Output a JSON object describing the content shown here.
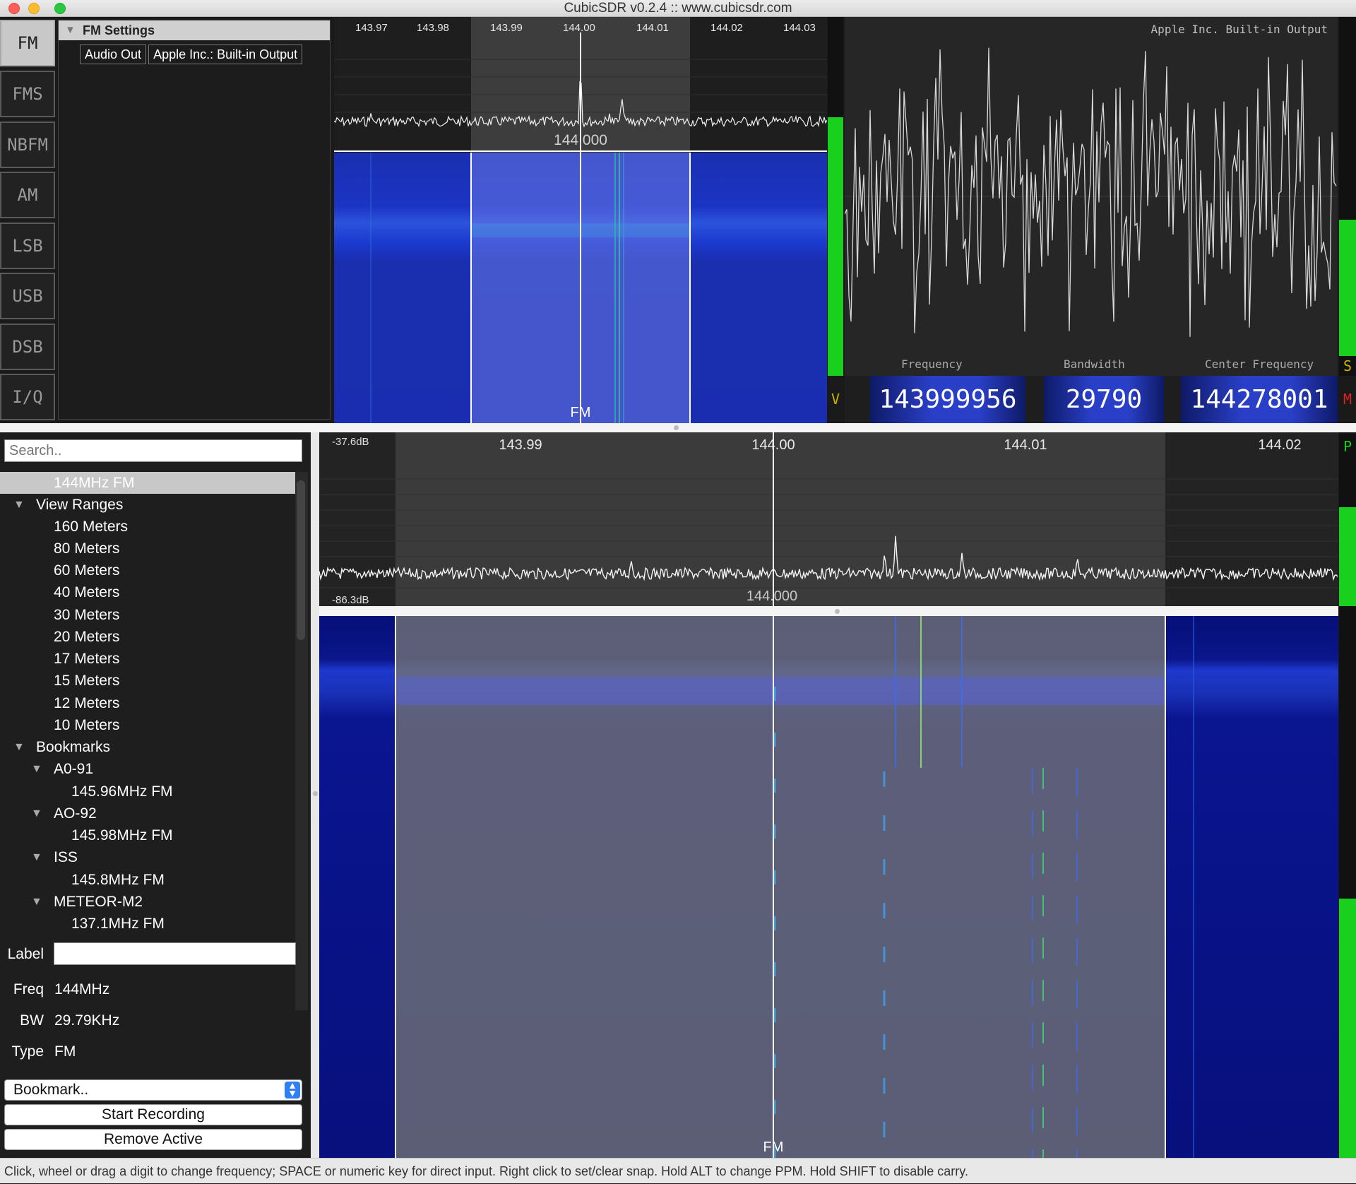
{
  "window": {
    "title": "CubicSDR v0.2.4 :: www.cubicsdr.com"
  },
  "modes": [
    "FM",
    "FMS",
    "NBFM",
    "AM",
    "LSB",
    "USB",
    "DSB",
    "I/Q"
  ],
  "active_mode": "FM",
  "settings": {
    "title": "FM Settings",
    "audio_out_label": "Audio Out",
    "audio_out_device": "Apple Inc.: Built-in Output"
  },
  "top_spectrum": {
    "ticks": [
      "143.97",
      "143.98",
      "143.99",
      "144.00",
      "144.01",
      "144.02",
      "144.03"
    ],
    "center_label": "144.000",
    "demod_label": "FM"
  },
  "scope": {
    "device_label": "Apple Inc. Built-in Output",
    "frequency_caption": "Frequency",
    "bandwidth_caption": "Bandwidth",
    "center_caption": "Center Frequency",
    "frequency_value": "143999956",
    "bandwidth_value": "29790",
    "center_value": "144278001",
    "meter_v": "V",
    "meter_s": "S",
    "meter_m": "M",
    "meter_p": "P"
  },
  "bookmarks": {
    "search_placeholder": "Search..",
    "active_item": "144MHz FM",
    "view_ranges_header": "View Ranges",
    "view_ranges": [
      "160 Meters",
      "80 Meters",
      "60 Meters",
      "40 Meters",
      "30 Meters",
      "20 Meters",
      "17 Meters",
      "15 Meters",
      "12 Meters",
      "10 Meters"
    ],
    "bookmarks_header": "Bookmarks",
    "groups": [
      {
        "name": "A0-91",
        "items": [
          "145.96MHz FM"
        ]
      },
      {
        "name": "AO-92",
        "items": [
          "145.98MHz FM"
        ]
      },
      {
        "name": "ISS",
        "items": [
          "145.8MHz FM"
        ]
      },
      {
        "name": "METEOR-M2",
        "items": [
          "137.1MHz FM"
        ]
      }
    ],
    "label_caption": "Label",
    "label_value": "",
    "freq_caption": "Freq",
    "freq_value": "144MHz",
    "bw_caption": "BW",
    "bw_value": "29.79KHz",
    "type_caption": "Type",
    "type_value": "FM",
    "bookmark_select": "Bookmark..",
    "start_recording": "Start Recording",
    "remove_active": "Remove Active"
  },
  "main_spectrum": {
    "db_top": "-37.6dB",
    "db_bottom": "-86.3dB",
    "ticks": [
      "143.99",
      "144.00",
      "144.01",
      "144.02"
    ],
    "center_label": "144.000",
    "demod_label": "FM"
  },
  "status_bar": "Click, wheel or drag a digit to change frequency; SPACE or numeric key for direct input. Right click to set/clear snap. Hold ALT to change PPM. Hold SHIFT to disable carry."
}
